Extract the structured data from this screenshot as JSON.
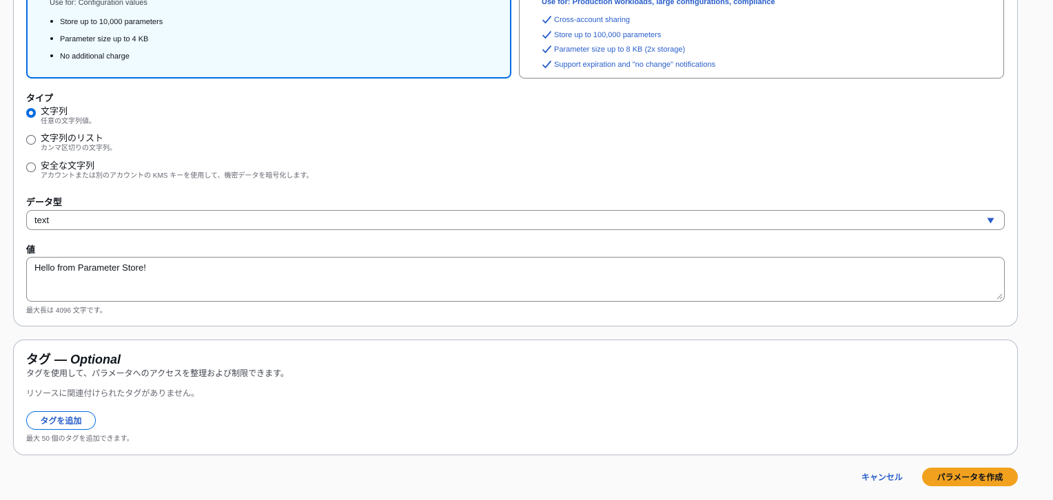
{
  "tiers": {
    "standard": {
      "use_for": "Use for: Configuration values",
      "features": [
        "Store up to 10,000 parameters",
        "Parameter size up to 4 KB",
        "No additional charge"
      ]
    },
    "advanced": {
      "use_for": "Use for: Production workloads, large configurations, compliance",
      "features": [
        "Cross-account sharing",
        "Store up to 100,000 parameters",
        "Parameter size up to 8 KB (2x storage)",
        "Support expiration and \"no change\" notifications"
      ]
    }
  },
  "type_section": {
    "label": "タイプ",
    "options": [
      {
        "label": "文字列",
        "description": "任意の文字列値。",
        "selected": true
      },
      {
        "label": "文字列のリスト",
        "description": "カンマ区切りの文字列。",
        "selected": false
      },
      {
        "label": "安全な文字列",
        "description": "アカウントまたは別のアカウントの KMS キーを使用して、機密データを暗号化します。",
        "selected": false
      }
    ]
  },
  "data_type": {
    "label": "データ型",
    "selected_value": "text"
  },
  "value_field": {
    "label": "値",
    "value": "Hello from Parameter Store!",
    "hint": "最大長は 4096 文字です。"
  },
  "tags": {
    "title": "タグ —",
    "title_optional": "Optional",
    "description": "タグを使用して、パラメータへのアクセスを整理および制限できます。",
    "empty_text": "リソースに関連付けられたタグがありません。",
    "add_button": "タグを追加",
    "hint": "最大 50 個のタグを追加できます。"
  },
  "footer": {
    "cancel_label": "キャンセル",
    "create_label": "パラメータを作成"
  },
  "colors": {
    "accent": "#006ce0",
    "link": "#295eca",
    "primary_button": "#f2a11f",
    "selected_tile_bg": "#f0fbff"
  }
}
